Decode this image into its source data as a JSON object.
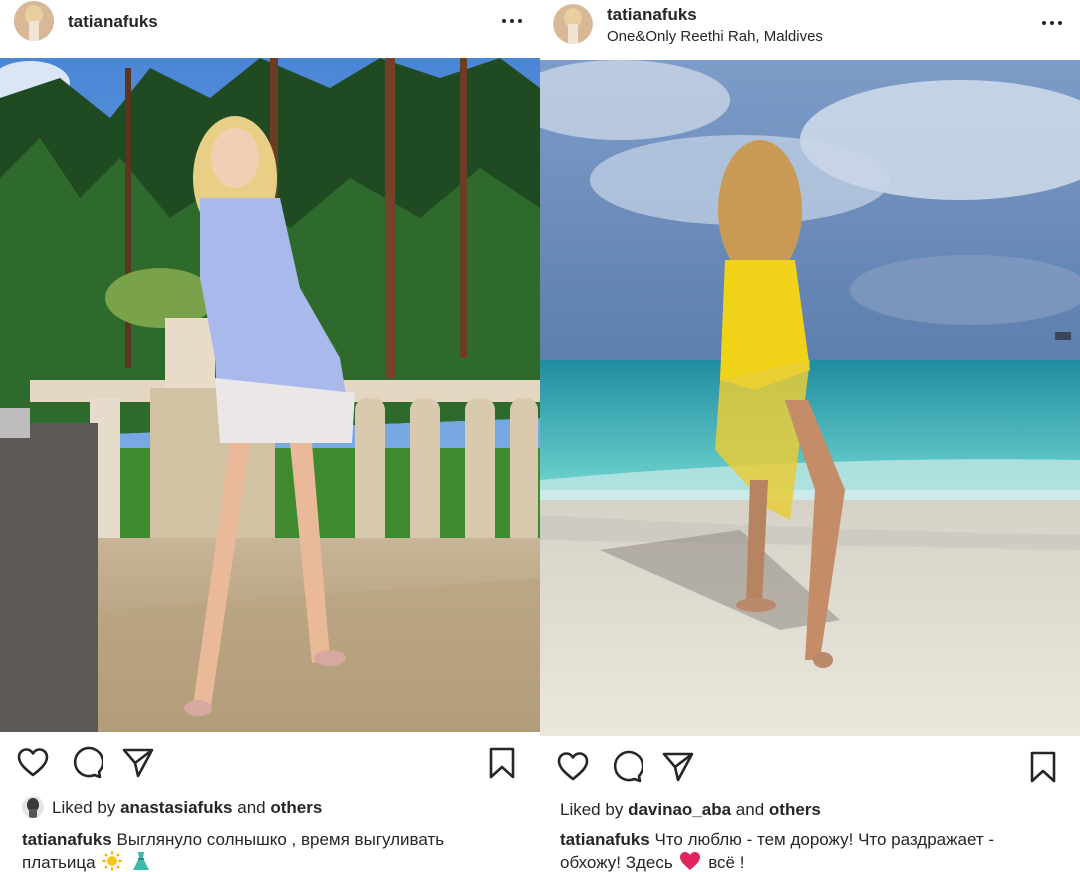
{
  "posts": [
    {
      "username": "tatianafuks",
      "location": "",
      "liked_prefix": "Liked by",
      "liked_user": "anastasiafuks",
      "liked_and": "and",
      "liked_others": "others",
      "caption_user": "tatianafuks",
      "caption_line1": "Выглянуло солнышко , время выгуливать",
      "caption_line2": "платьица"
    },
    {
      "username": "tatianafuks",
      "location": "One&Only Reethi Rah, Maldives",
      "liked_prefix": "Liked by",
      "liked_user": "davinao_aba",
      "liked_and": "and",
      "liked_others": "others",
      "caption_user": "tatianafuks",
      "caption_line1": "Что люблю - тем дорожу! Что раздражает -",
      "caption_line2a": "обхожу! Здесь",
      "caption_line2b": "всё !"
    }
  ],
  "icons": {
    "like": "heart-icon",
    "comment": "comment-bubble-icon",
    "share": "paper-plane-icon",
    "save": "bookmark-icon",
    "more": "more-dots-icon",
    "emoji_sun": "sun-emoji",
    "emoji_dress": "dress-emoji",
    "emoji_heart": "red-heart-emoji"
  },
  "colors": {
    "text": "#262626",
    "heart_emoji": "#e0245e"
  }
}
